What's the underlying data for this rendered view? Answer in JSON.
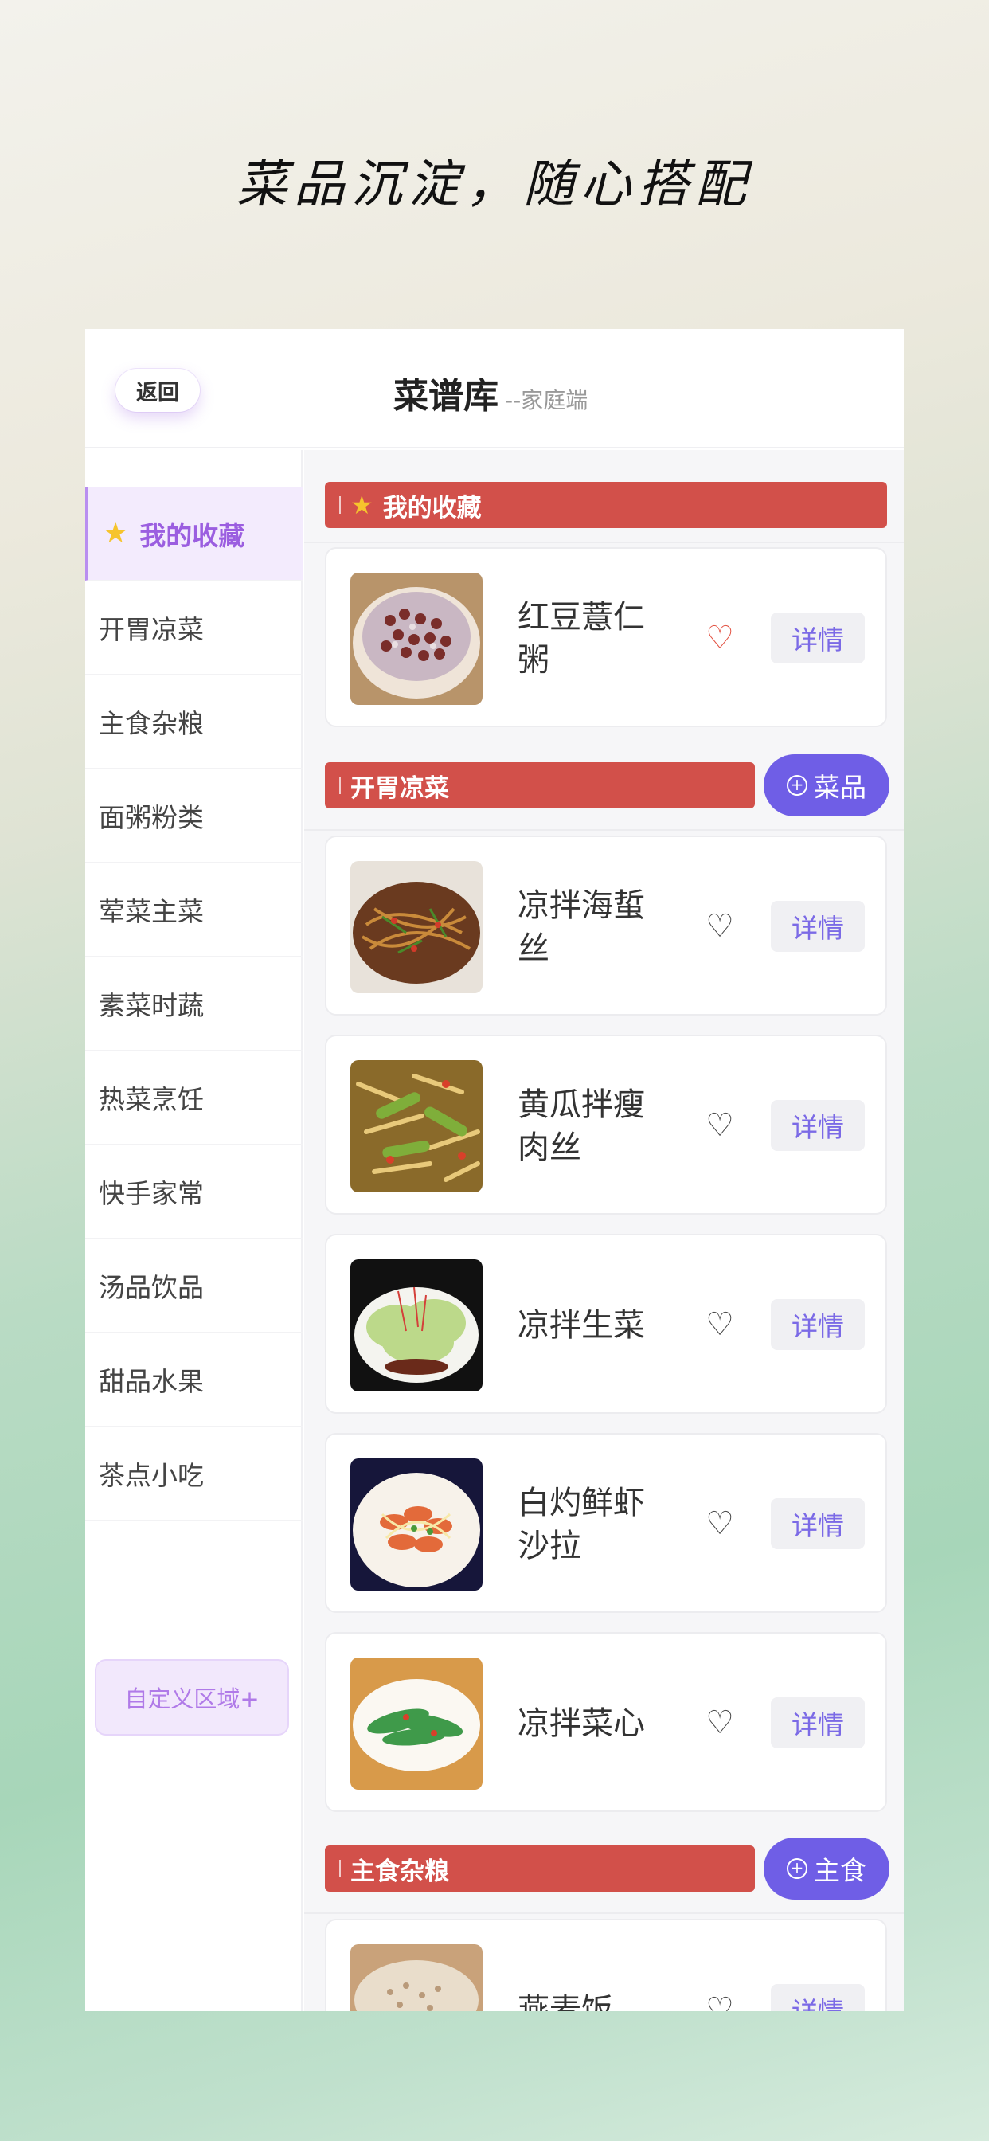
{
  "tagline": "菜品沉淀，随心搭配",
  "header": {
    "back_label": "返回",
    "title": "菜谱库",
    "subtitle": "--家庭端"
  },
  "sidebar": {
    "items": [
      {
        "label": "我的收藏",
        "active": true,
        "icon": "star-icon"
      },
      {
        "label": "开胃凉菜"
      },
      {
        "label": "主食杂粮"
      },
      {
        "label": "面粥粉类"
      },
      {
        "label": "荤菜主菜"
      },
      {
        "label": "素菜时蔬"
      },
      {
        "label": "热菜烹饪"
      },
      {
        "label": "快手家常"
      },
      {
        "label": "汤品饮品"
      },
      {
        "label": "甜品水果"
      },
      {
        "label": "茶点小吃"
      }
    ],
    "custom_label": "自定义区域+"
  },
  "sections": {
    "favorites": {
      "title": "我的收藏",
      "dishes": [
        {
          "name": "红豆薏仁粥",
          "favorited": true,
          "detail_label": "详情"
        }
      ]
    },
    "appetizers": {
      "title": "开胃凉菜",
      "add_label": "菜品",
      "dishes": [
        {
          "name": "凉拌海蜇丝",
          "favorited": false,
          "detail_label": "详情"
        },
        {
          "name": "黄瓜拌瘦肉丝",
          "favorited": false,
          "detail_label": "详情"
        },
        {
          "name": "凉拌生菜",
          "favorited": false,
          "detail_label": "详情"
        },
        {
          "name": "白灼鲜虾沙拉",
          "favorited": false,
          "detail_label": "详情"
        },
        {
          "name": "凉拌菜心",
          "favorited": false,
          "detail_label": "详情"
        }
      ]
    },
    "staples": {
      "title": "主食杂粮",
      "add_label": "主食",
      "dishes": [
        {
          "name": "燕麦饭",
          "favorited": false,
          "detail_label": "详情"
        }
      ]
    }
  },
  "colors": {
    "section_bar": "#d2504a",
    "accent_purple": "#6f5ee6",
    "active_sidebar": "#9b5ee0",
    "favorite_heart": "#e24f3f"
  }
}
